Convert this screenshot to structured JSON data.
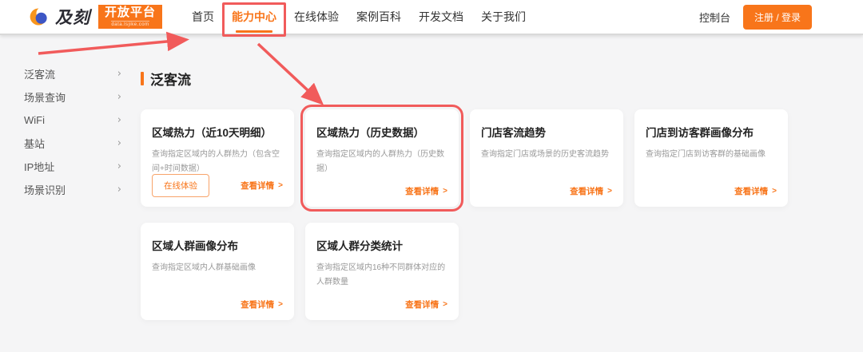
{
  "brand": {
    "logo_text": "及刻",
    "badge": "开放平台",
    "badge_sub": "data.lsjike.com"
  },
  "header": {
    "nav": [
      {
        "label": "首页"
      },
      {
        "label": "能力中心"
      },
      {
        "label": "在线体验"
      },
      {
        "label": "案例百科"
      },
      {
        "label": "开发文档"
      },
      {
        "label": "关于我们"
      }
    ],
    "active_nav": "能力中心",
    "console_label": "控制台",
    "login_label": "注册 / 登录"
  },
  "sidebar": {
    "items": [
      {
        "label": "泛客流"
      },
      {
        "label": "场景查询"
      },
      {
        "label": "WiFi"
      },
      {
        "label": "基站"
      },
      {
        "label": "IP地址"
      },
      {
        "label": "场景识别"
      }
    ]
  },
  "main": {
    "section_title": "泛客流",
    "cards": [
      {
        "title": "区域热力（近10天明细）",
        "desc": "查询指定区域内的人群热力（包含空间+时间数据）",
        "try_label": "在线体验",
        "detail_label": "查看详情"
      },
      {
        "title": "区域热力（历史数据）",
        "desc": "查询指定区域内的人群热力（历史数据）",
        "detail_label": "查看详情"
      },
      {
        "title": "门店客流趋势",
        "desc": "查询指定门店或场景的历史客流趋势",
        "detail_label": "查看详情"
      },
      {
        "title": "门店到访客群画像分布",
        "desc": "查询指定门店到访客群的基础画像",
        "detail_label": "查看详情"
      },
      {
        "title": "区域人群画像分布",
        "desc": "查询指定区域内人群基础画像",
        "detail_label": "查看详情"
      },
      {
        "title": "区域人群分类统计",
        "desc": "查询指定区域内16种不同群体对应的人群数量",
        "detail_label": "查看详情"
      }
    ]
  },
  "icons": {
    "chevron_right": "›",
    "link_arrow": ">"
  },
  "colors": {
    "accent_orange": "#F8751A",
    "annotation_red": "#F15B5B",
    "logo_blue": "#3D56C5",
    "page_background": "#F5F5F6"
  }
}
